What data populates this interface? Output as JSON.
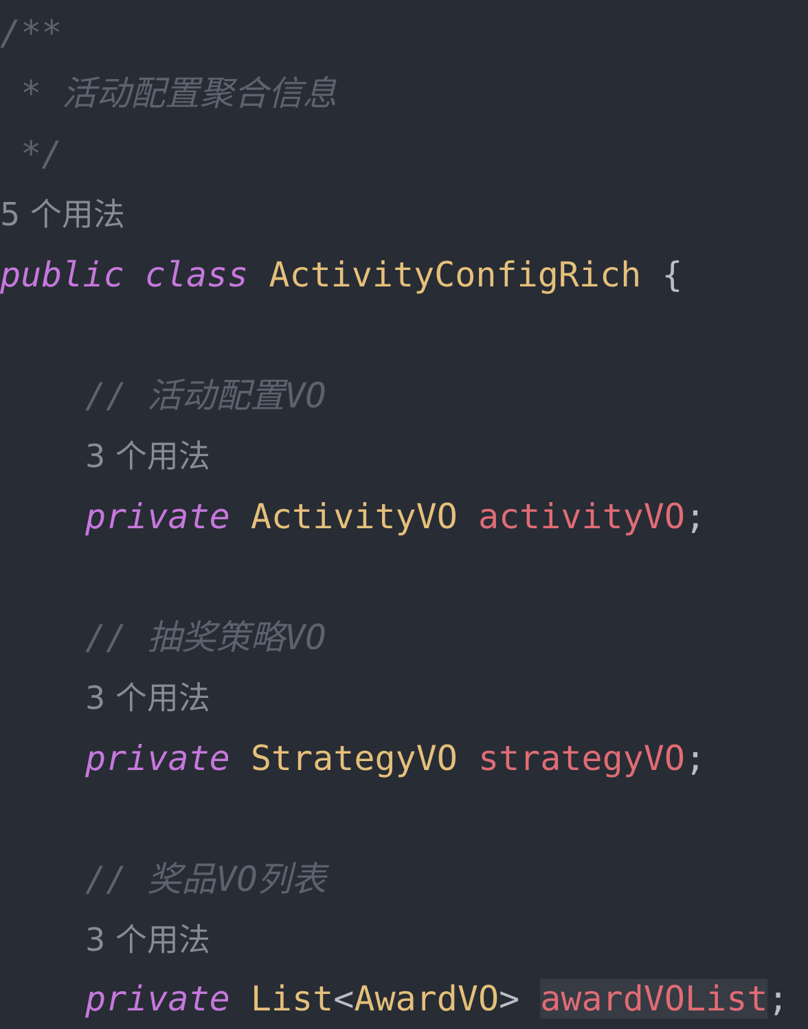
{
  "code": {
    "doc_open": "/**",
    "doc_text": " * 活动配置聚合信息",
    "doc_close": " */",
    "class_usages": "5 个用法",
    "class_decl": {
      "kw_public": "public",
      "kw_class": "class",
      "name": "ActivityConfigRich",
      "brace": "{"
    },
    "fields": [
      {
        "comment": "// 活动配置VO",
        "usages": "3 个用法",
        "modifier": "private",
        "type": "ActivityVO",
        "name": "activityVO",
        "semicolon": ";"
      },
      {
        "comment": "// 抽奖策略VO",
        "usages": "3 个用法",
        "modifier": "private",
        "type": "StrategyVO",
        "name": "strategyVO",
        "semicolon": ";"
      },
      {
        "comment": "// 奖品VO列表",
        "usages": "3 个用法",
        "modifier": "private",
        "type_base": "List",
        "type_lt": "<",
        "type_arg": "AwardVO",
        "type_gt": ">",
        "name": "awardVOList",
        "semicolon": ";"
      }
    ]
  },
  "colors": {
    "background": "#282c34",
    "keyword": "#c678dd",
    "type": "#e5c07b",
    "field": "#e06c75",
    "comment": "#5c6370",
    "usage_hint": "#878c96",
    "text": "#bbbec4",
    "selection_highlight": "#373b43"
  }
}
